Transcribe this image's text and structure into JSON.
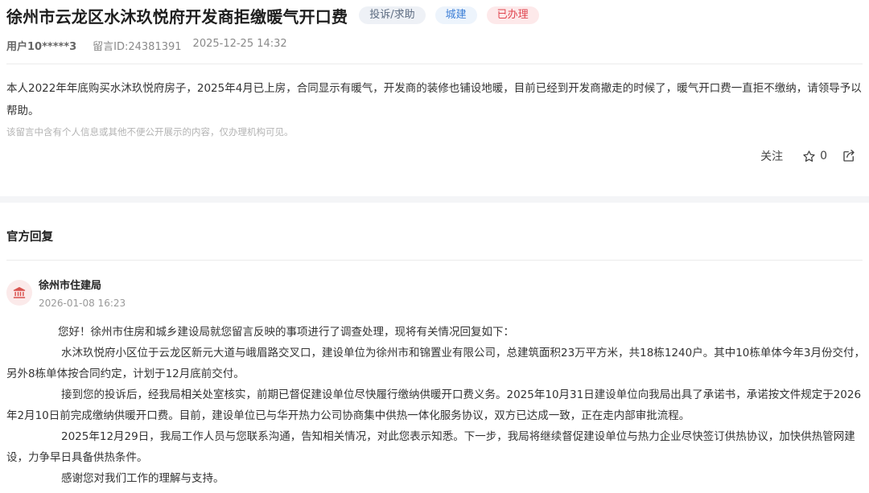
{
  "header": {
    "title": "徐州市云龙区水沐玖悦府开发商拒缴暖气开口费",
    "tags": [
      {
        "label": "投诉/求助",
        "color": "#5c6b80"
      },
      {
        "label": "城建",
        "color": "#3d7fd6"
      },
      {
        "label": "已办理",
        "color": "#e0454f"
      }
    ]
  },
  "meta": {
    "user": "用户10*****3",
    "message_id": "留言ID:24381391",
    "datetime": "2025-12-25 14:32"
  },
  "message": {
    "content": "本人2022年年底购买水沐玖悦府房子，2025年4月已上房，合同显示有暖气，开发商的装修也铺设地暖，目前已经到开发商撤走的时候了，暖气开口费一直拒不缴纳，请领导予以帮助。",
    "privacy_notice": "该留言中含有个人信息或其他不便公开展示的内容，仅办理机构可见。"
  },
  "actions": {
    "follow_label": "关注",
    "star_count": "0",
    "icons": [
      "star-icon",
      "share-icon"
    ]
  },
  "official_reply": {
    "section_title": "官方回复",
    "org_name": "徐州市住建局",
    "org_icon": "government-building-icon",
    "date": "2026-01-08 16:23",
    "paragraphs": [
      "您好！徐州市住房和城乡建设局就您留言反映的事项进行了调查处理，现将有关情况回复如下：",
      "水沐玖悦府小区位于云龙区新元大道与峨眉路交叉口，建设单位为徐州市和锦置业有限公司，总建筑面积23万平方米，共18栋1240户。其中10栋单体今年3月份交付，另外8栋单体按合同约定，计划于12月底前交付。",
      "接到您的投诉后，经我局相关处室核实，前期已督促建设单位尽快履行缴纳供暖开口费义务。2025年10月31日建设单位向我局出具了承诺书，承诺按文件规定于2026年2月10日前完成缴纳供暖开口费。目前，建设单位已与华开热力公司协商集中供热一体化服务协议，双方已达成一致，正在走内部审批流程。",
      "2025年12月29日，我局工作人员与您联系沟通，告知相关情况，对此您表示知悉。下一步，我局将继续督促建设单位与热力企业尽快签订供热协议，加快供热管网建设，力争早日具备供热条件。",
      "感谢您对我们工作的理解与支持。"
    ]
  },
  "colors": {
    "accent_blue": "#3d7fd6",
    "accent_red": "#e0454f",
    "band_gray": "#f4f5f7"
  }
}
